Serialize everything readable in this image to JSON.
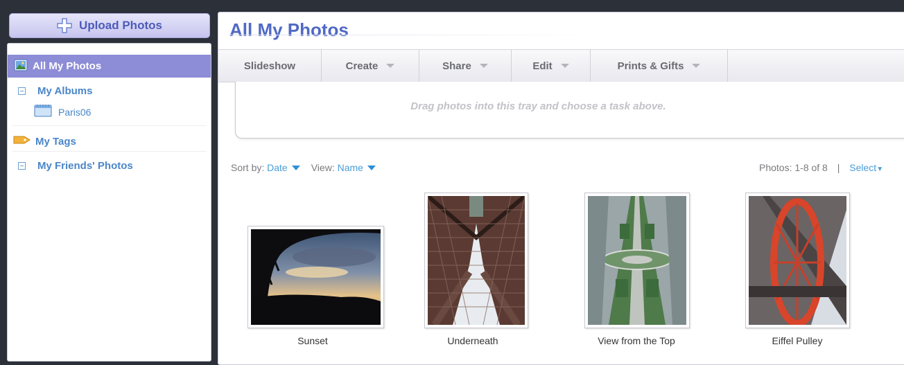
{
  "sidebar": {
    "upload_label": "Upload Photos",
    "items": [
      {
        "label": "All My Photos",
        "icon": "photos-icon",
        "active": true
      },
      {
        "label": "My Albums",
        "icon": "collapse-icon"
      },
      {
        "label": "Paris06",
        "icon": "album-icon"
      },
      {
        "label": "My Tags",
        "icon": "tag-icon"
      },
      {
        "label": "My Friends' Photos",
        "icon": "collapse-icon"
      }
    ]
  },
  "main": {
    "title": "All My Photos",
    "toolbar": [
      "Slideshow",
      "Create",
      "Share",
      "Edit",
      "Prints & Gifts"
    ],
    "tray_text": "Drag photos into this tray and choose a task above.",
    "sort_label": "Sort by:",
    "sort_value": "Date",
    "view_label": "View:",
    "view_value": "Name",
    "count_text": "Photos: 1-8 of 8",
    "separator": "|",
    "select_label": "Select"
  },
  "photos": [
    {
      "caption": "Sunset"
    },
    {
      "caption": "Underneath"
    },
    {
      "caption": "View from the Top"
    },
    {
      "caption": "Eiffel Pulley"
    }
  ],
  "colors": {
    "accent": "#8d8cd6",
    "title": "#5069c4",
    "link": "#4a9ed8",
    "background": "#2c3039"
  }
}
